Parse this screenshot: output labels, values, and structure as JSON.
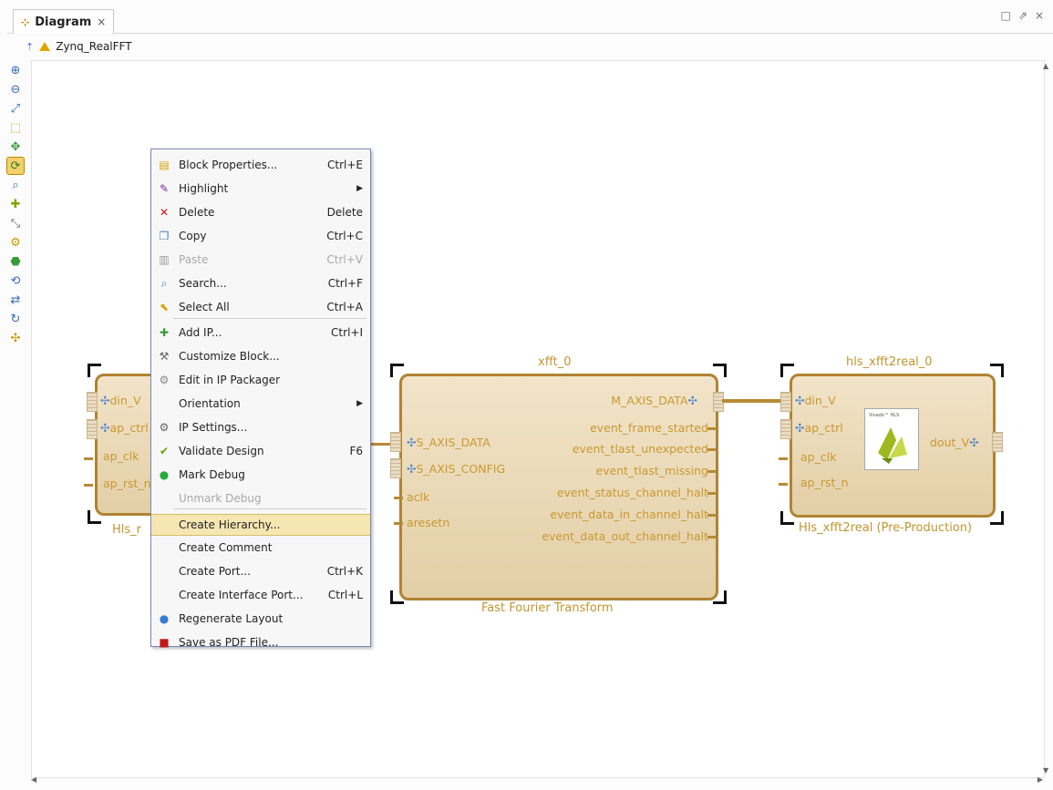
{
  "tab": {
    "title": "Diagram",
    "close": "×"
  },
  "window_controls": [
    "□",
    "⇗",
    "×"
  ],
  "breadcrumb": {
    "name": "Zynq_RealFFT"
  },
  "toolbar": [
    "zoom-in-icon",
    "zoom-out-icon",
    "zoom-fit-icon",
    "select-area-icon",
    "expand-icon",
    "auto-connect-icon",
    "search-icon",
    "add-ip-icon",
    "route-icon",
    "validate-icon",
    "regenerate-icon",
    "refresh-icon",
    "settings-icon",
    "drag-icon",
    "pin-icon"
  ],
  "context_menu": {
    "items": [
      {
        "label": "Block Properties...",
        "shortcut": "Ctrl+E",
        "icon": "properties-icon",
        "glyph": "▤",
        "color": "#d8a000",
        "disabled": false
      },
      {
        "label": "Highlight",
        "shortcut": "",
        "submenu": true,
        "icon": "highlight-icon",
        "glyph": "✎",
        "color": "#7a2aa8",
        "disabled": false
      },
      {
        "label": "Delete",
        "shortcut": "Delete",
        "icon": "delete-icon",
        "glyph": "✕",
        "color": "#d01010",
        "disabled": false
      },
      {
        "label": "Copy",
        "shortcut": "Ctrl+C",
        "icon": "copy-icon",
        "glyph": "❐",
        "color": "#4a7ab8",
        "disabled": false
      },
      {
        "label": "Paste",
        "shortcut": "Ctrl+V",
        "icon": "paste-icon",
        "glyph": "▥",
        "color": "#999999",
        "disabled": true
      },
      {
        "label": "Search...",
        "shortcut": "Ctrl+F",
        "icon": "search-icon",
        "glyph": "⌕",
        "color": "#4a7ab8",
        "disabled": false
      },
      {
        "label": "Select All",
        "shortcut": "Ctrl+A",
        "icon": "select-all-icon",
        "glyph": "⬉",
        "color": "#d8a000",
        "disabled": false
      },
      {
        "label": "Add IP...",
        "shortcut": "Ctrl+I",
        "icon": "add-ip-icon",
        "glyph": "✚",
        "color": "#3a9a3a",
        "disabled": false
      },
      {
        "label": "Customize Block...",
        "shortcut": "",
        "icon": "customize-icon",
        "glyph": "⚒",
        "color": "#666666",
        "disabled": false
      },
      {
        "label": "Edit in IP Packager",
        "shortcut": "",
        "icon": "packager-icon",
        "glyph": "⚙",
        "color": "#888888",
        "disabled": false
      },
      {
        "label": "Orientation",
        "shortcut": "",
        "submenu": true,
        "icon": "",
        "glyph": "",
        "color": "#000",
        "disabled": false
      },
      {
        "label": "IP Settings...",
        "shortcut": "",
        "icon": "settings-icon",
        "glyph": "⚙",
        "color": "#666666",
        "disabled": false
      },
      {
        "label": "Validate Design",
        "shortcut": "F6",
        "icon": "validate-icon",
        "glyph": "✔",
        "color": "#6aa000",
        "disabled": false
      },
      {
        "label": "Mark Debug",
        "shortcut": "",
        "icon": "debug-icon",
        "glyph": "●",
        "color": "#2aaa3a",
        "disabled": false
      },
      {
        "label": "Unmark Debug",
        "shortcut": "",
        "icon": "",
        "glyph": "",
        "color": "#000",
        "disabled": true
      },
      {
        "label": "Create Hierarchy...",
        "shortcut": "",
        "icon": "",
        "glyph": "",
        "color": "#000",
        "disabled": false,
        "highlighted": true
      },
      {
        "label": "Create Comment",
        "shortcut": "",
        "icon": "",
        "glyph": "",
        "color": "#000",
        "disabled": false
      },
      {
        "label": "Create Port...",
        "shortcut": "Ctrl+K",
        "icon": "",
        "glyph": "",
        "color": "#000",
        "disabled": false
      },
      {
        "label": "Create Interface Port...",
        "shortcut": "Ctrl+L",
        "icon": "",
        "glyph": "",
        "color": "#000",
        "disabled": false
      },
      {
        "label": "Regenerate Layout",
        "shortcut": "",
        "icon": "regenerate-icon",
        "glyph": "●",
        "color": "#3a7ad8",
        "disabled": false
      },
      {
        "label": "Save as PDF File...",
        "shortcut": "",
        "icon": "pdf-icon",
        "glyph": "■",
        "color": "#c01818",
        "disabled": false
      }
    ]
  },
  "blocks": {
    "left": {
      "name": "Hls_r",
      "ports": [
        "din_V",
        "ap_ctrl",
        "ap_clk",
        "ap_rst_n"
      ]
    },
    "xfft": {
      "title": "xfft_0",
      "name": "Fast Fourier Transform",
      "in_ports": [
        "S_AXIS_DATA",
        "S_AXIS_CONFIG",
        "aclk",
        "aresetn"
      ],
      "out_ports": [
        "M_AXIS_DATA",
        "event_frame_started",
        "event_tlast_unexpected",
        "event_tlast_missing",
        "event_status_channel_halt",
        "event_data_in_channel_halt",
        "event_data_out_channel_halt"
      ]
    },
    "xfft2real": {
      "title": "hls_xfft2real_0",
      "name": "Hls_xfft2real (Pre-Production)",
      "in_ports": [
        "din_V",
        "ap_ctrl",
        "ap_clk",
        "ap_rst_n"
      ],
      "out_ports": [
        "dout_V"
      ],
      "logo_text": "Vivado™ HLS"
    }
  }
}
